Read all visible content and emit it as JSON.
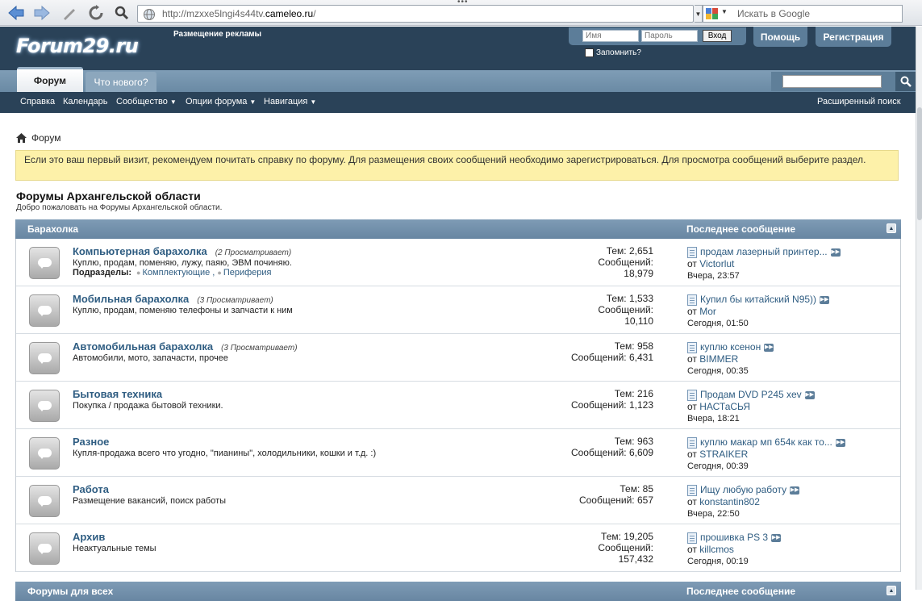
{
  "browser": {
    "url_prefix": "http://mzxxe5lngi4s44tv.",
    "url_domain": "cameleo.ru",
    "url_suffix": "/",
    "search_placeholder": "Искать в Google"
  },
  "header": {
    "logo": "Forum29.ru",
    "ad_link": "Размещение рекламы",
    "username_placeholder": "Имя",
    "password_placeholder": "Пароль",
    "login_button": "Вход",
    "remember": "Запомнить?",
    "help_button": "Помощь",
    "register_button": "Регистрация"
  },
  "tabs": {
    "active": "Форум",
    "whats_new": "Что нового?"
  },
  "subnav": {
    "help": "Справка",
    "calendar": "Календарь",
    "community": "Сообщество",
    "forum_options": "Опции форума",
    "navigation": "Навигация",
    "advanced_search": "Расширенный поиск"
  },
  "breadcrumb": "Форум",
  "notice": "Если это ваш первый визит, рекомендуем почитать справку по форуму. Для размещения своих сообщений необходимо зарегистрироваться. Для просмотра сообщений выберите раздел.",
  "page_title": "Форумы Архангельской области",
  "page_subtitle": "Добро пожаловать на Форумы Архангельской области.",
  "section1": {
    "title": "Барахолка",
    "last_post_header": "Последнее сообщение"
  },
  "section2": {
    "title": "Форумы для всех",
    "last_post_header": "Последнее сообщение"
  },
  "stats_labels": {
    "threads": "Тем:",
    "posts": "Сообщений:"
  },
  "forums": [
    {
      "title": "Компьютерная барахолка",
      "viewers": "(2 Просматривает)",
      "desc": "Куплю, продам, поменяю, лужу, паяю, ЭВМ починяю.",
      "subforums_label": "Подразделы:",
      "subforums": [
        "Комплектующие ,",
        "Периферия"
      ],
      "threads": "2,651",
      "posts": "18,979",
      "last_title": "продам лазерный принтер...",
      "by": "от",
      "last_user": "Victorlut",
      "last_time": "Вчера, 23:57"
    },
    {
      "title": "Мобильная барахолка",
      "viewers": "(3 Просматривает)",
      "desc": "Куплю, продам, поменяю телефоны и запчасти к ним",
      "threads": "1,533",
      "posts": "10,110",
      "last_title": "Купил бы китайский N95))",
      "by": "от",
      "last_user": "Mor",
      "last_time": "Сегодня, 01:50"
    },
    {
      "title": "Автомобильная барахолка",
      "viewers": "(3 Просматривает)",
      "desc": "Автомобили, мото, запачасти, прочее",
      "threads": "958",
      "posts": "6,431",
      "last_title": "куплю ксенон",
      "by": "от",
      "last_user": "BIMMER",
      "last_time": "Сегодня, 00:35"
    },
    {
      "title": "Бытовая техника",
      "viewers": "",
      "desc": "Покупка / продажа бытовой техники.",
      "threads": "216",
      "posts": "1,123",
      "last_title": "Продам DVD P245 xev",
      "by": "от",
      "last_user": "НАСТаСЬЯ",
      "last_time": "Вчера, 18:21"
    },
    {
      "title": "Разное",
      "viewers": "",
      "desc": "Купля-продажа всего что угодно, \"пианины\", холодильники, кошки и т.д. :)",
      "threads": "963",
      "posts": "6,609",
      "last_title": "куплю макар мп 654к как то...",
      "by": "от",
      "last_user": "STRAIKER",
      "last_time": "Сегодня, 00:39"
    },
    {
      "title": "Работа",
      "viewers": "",
      "desc": "Размещение вакансий, поиск работы",
      "threads": "85",
      "posts": "657",
      "last_title": "Ищу любую работу",
      "by": "от",
      "last_user": "konstantin802",
      "last_time": "Вчера, 22:50"
    },
    {
      "title": "Архив",
      "viewers": "",
      "desc": "Неактуальные темы",
      "threads": "19,205",
      "posts": "157,432",
      "last_title": "прошивка PS 3",
      "by": "от",
      "last_user": "killcmos",
      "last_time": "Сегодня, 00:19"
    }
  ]
}
